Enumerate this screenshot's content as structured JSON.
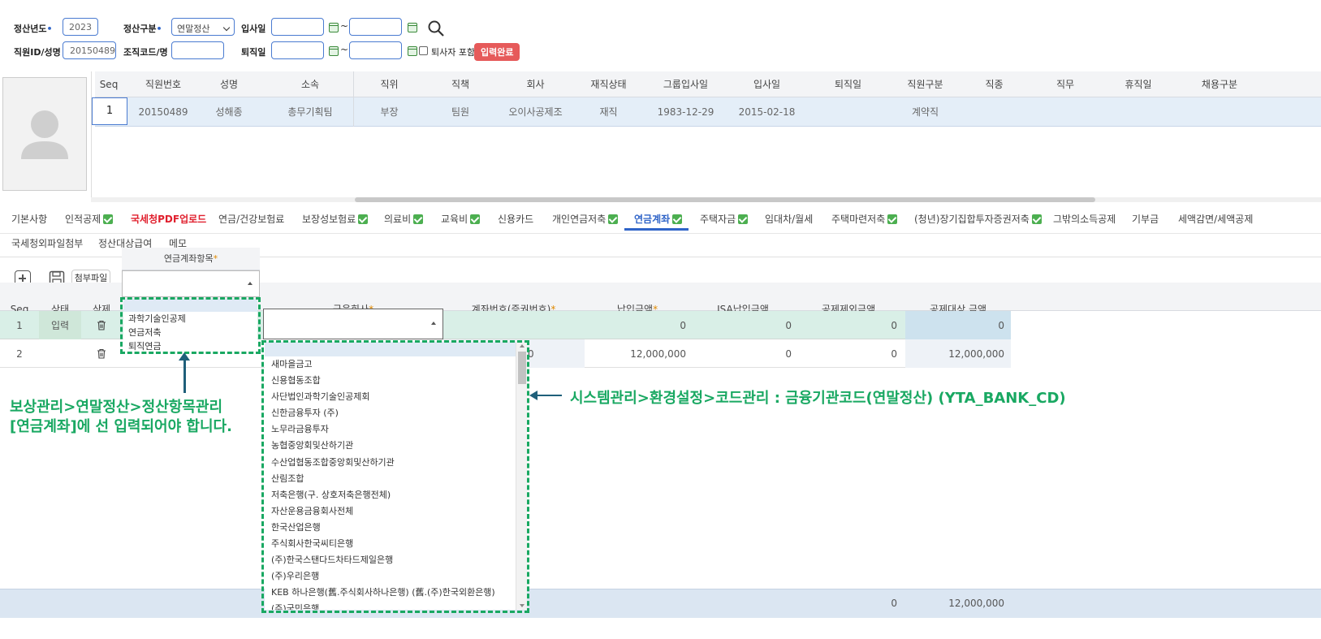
{
  "filters": {
    "year_label": "정산년도",
    "year_value": "2023",
    "type_label": "정산구분",
    "type_value": "연말정산",
    "hire_label": "입사일",
    "leave_label": "퇴직일",
    "tilde": "~",
    "emp_label": "직원ID/성명",
    "emp_value": "20150489",
    "org_label": "조직코드/명",
    "include_retired_label": "퇴사자 포함",
    "status_badge": "입력완료"
  },
  "employee_grid": {
    "headers": [
      "Seq",
      "직원번호",
      "성명",
      "소속",
      "직위",
      "직책",
      "회사",
      "재직상태",
      "그룹입사일",
      "입사일",
      "퇴직일",
      "직원구분",
      "직종",
      "직무",
      "휴직일",
      "채용구분"
    ],
    "row": [
      "1",
      "20150489",
      "성해종",
      "총무기획팀",
      "부장",
      "팀원",
      "오이사공제조",
      "재직",
      "1983-12-29",
      "2015-02-18",
      "",
      "계약직",
      "",
      "",
      "",
      ""
    ]
  },
  "tabs": [
    {
      "label": "기본사항",
      "check": false,
      "style": "normal"
    },
    {
      "label": "인적공제",
      "check": true,
      "style": "normal"
    },
    {
      "label": "국세청PDF업로드",
      "check": false,
      "style": "red"
    },
    {
      "label": "연금/건강보험료",
      "check": false,
      "style": "normal"
    },
    {
      "label": "보장성보험료",
      "check": true,
      "style": "normal"
    },
    {
      "label": "의료비",
      "check": true,
      "style": "normal"
    },
    {
      "label": "교육비",
      "check": true,
      "style": "normal"
    },
    {
      "label": "신용카드",
      "check": false,
      "style": "normal"
    },
    {
      "label": "개인연금저축",
      "check": true,
      "style": "normal"
    },
    {
      "label": "연금계좌",
      "check": true,
      "style": "active"
    },
    {
      "label": "주택자금",
      "check": true,
      "style": "normal"
    },
    {
      "label": "임대차/월세",
      "check": false,
      "style": "normal"
    },
    {
      "label": "주택마련저축",
      "check": true,
      "style": "normal"
    },
    {
      "label": "(청년)장기집합투자증권저축",
      "check": true,
      "style": "normal"
    },
    {
      "label": "그밖의소득공제",
      "check": false,
      "style": "normal"
    },
    {
      "label": "기부금",
      "check": false,
      "style": "normal"
    },
    {
      "label": "세액감면/세액공제",
      "check": false,
      "style": "normal"
    }
  ],
  "tabs_row2": [
    "국세청외파일첨부",
    "정산대상급여",
    "메모"
  ],
  "toolbar": {
    "attach_label": "첨부파일"
  },
  "pension_grid": {
    "headers": {
      "seq": "Seq",
      "status": "상태",
      "delete": "삭제",
      "item": "연금계좌항목",
      "company": "금융회사",
      "account": "계좌번호(증권번호)",
      "amount": "납입금액",
      "isa": "ISA납입금액",
      "excluded": "공제제외금액",
      "target": "공제대상 금액"
    },
    "rows": [
      {
        "seq": "1",
        "status": "입력",
        "amount": "0",
        "isa": "0",
        "excluded": "0",
        "target": "0"
      },
      {
        "seq": "2",
        "status": "",
        "account_tail": "0",
        "amount": "12,000,000",
        "isa": "0",
        "excluded": "0",
        "target": "12,000,000"
      }
    ],
    "footer": {
      "excluded": "0",
      "target": "12,000,000"
    }
  },
  "item_dropdown": [
    "과학기술인공제",
    "연금저축",
    "퇴직연금"
  ],
  "bank_dropdown": [
    "새마을금고",
    "신용협동조합",
    "사단법인과학기술인공제회",
    "신한금융투자 (주)",
    "노무라금융투자",
    "농협중앙회및산하기관",
    "수산업협동조합중앙회및산하기관",
    "산림조합",
    "저축은행(구. 상호저축은행전체)",
    "자산운용금융회사전체",
    "한국산업은행",
    "주식회사한국씨티은행",
    "(주)한국스탠다드차타드제일은행",
    "(주)우리은행",
    "KEB 하나은행(舊.주식회사하나은행) (舊.(주)한국외환은행)",
    "(주)국민은행"
  ],
  "annotations": {
    "left_line1": "보상관리>연말정산>정산항목관리",
    "left_line2": "[연금계좌]에 선 입력되어야 합니다.",
    "right": "시스템관리>환경설정>코드관리 : 금융기관코드(연말정산) (YTA_BANK_CD)"
  },
  "colors": {
    "accent": "#2f64c8",
    "annotation": "#19a862",
    "badge": "#e65a5a"
  }
}
